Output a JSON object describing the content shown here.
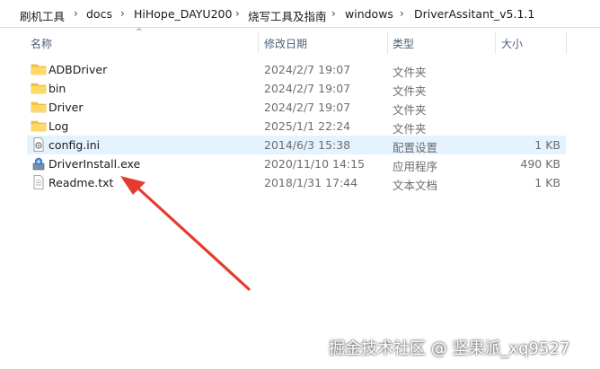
{
  "breadcrumb": {
    "items": [
      "刷机工具",
      "docs",
      "HiHope_DAYU200",
      "烧写工具及指南",
      "windows",
      "DriverAssitant_v5.1.1"
    ],
    "separator": "›"
  },
  "columns": {
    "name": "名称",
    "modified": "修改日期",
    "type": "类型",
    "size": "大小",
    "sort_indicator": "^"
  },
  "files": [
    {
      "name": "ADBDriver",
      "modified": "2024/2/7 19:07",
      "type": "文件夹",
      "size": "",
      "icon": "folder-icon"
    },
    {
      "name": "bin",
      "modified": "2024/2/7 19:07",
      "type": "文件夹",
      "size": "",
      "icon": "folder-icon"
    },
    {
      "name": "Driver",
      "modified": "2024/2/7 19:07",
      "type": "文件夹",
      "size": "",
      "icon": "folder-icon"
    },
    {
      "name": "Log",
      "modified": "2025/1/1 22:24",
      "type": "文件夹",
      "size": "",
      "icon": "folder-icon"
    },
    {
      "name": "config.ini",
      "modified": "2014/6/3 15:38",
      "type": "配置设置",
      "size": "1 KB",
      "icon": "config-file-icon",
      "selected": true
    },
    {
      "name": "DriverInstall.exe",
      "modified": "2020/11/10 14:15",
      "type": "应用程序",
      "size": "490 KB",
      "icon": "installer-icon"
    },
    {
      "name": "Readme.txt",
      "modified": "2018/1/31 17:44",
      "type": "文本文档",
      "size": "1 KB",
      "icon": "text-file-icon"
    }
  ],
  "watermark": "掘金技术社区 @ 坚果派_xq9527",
  "colors": {
    "selection": "#e5f3ff",
    "folder": "#f4c542",
    "annotation_arrow": "#e53b2c",
    "header_text": "#4c607a"
  }
}
